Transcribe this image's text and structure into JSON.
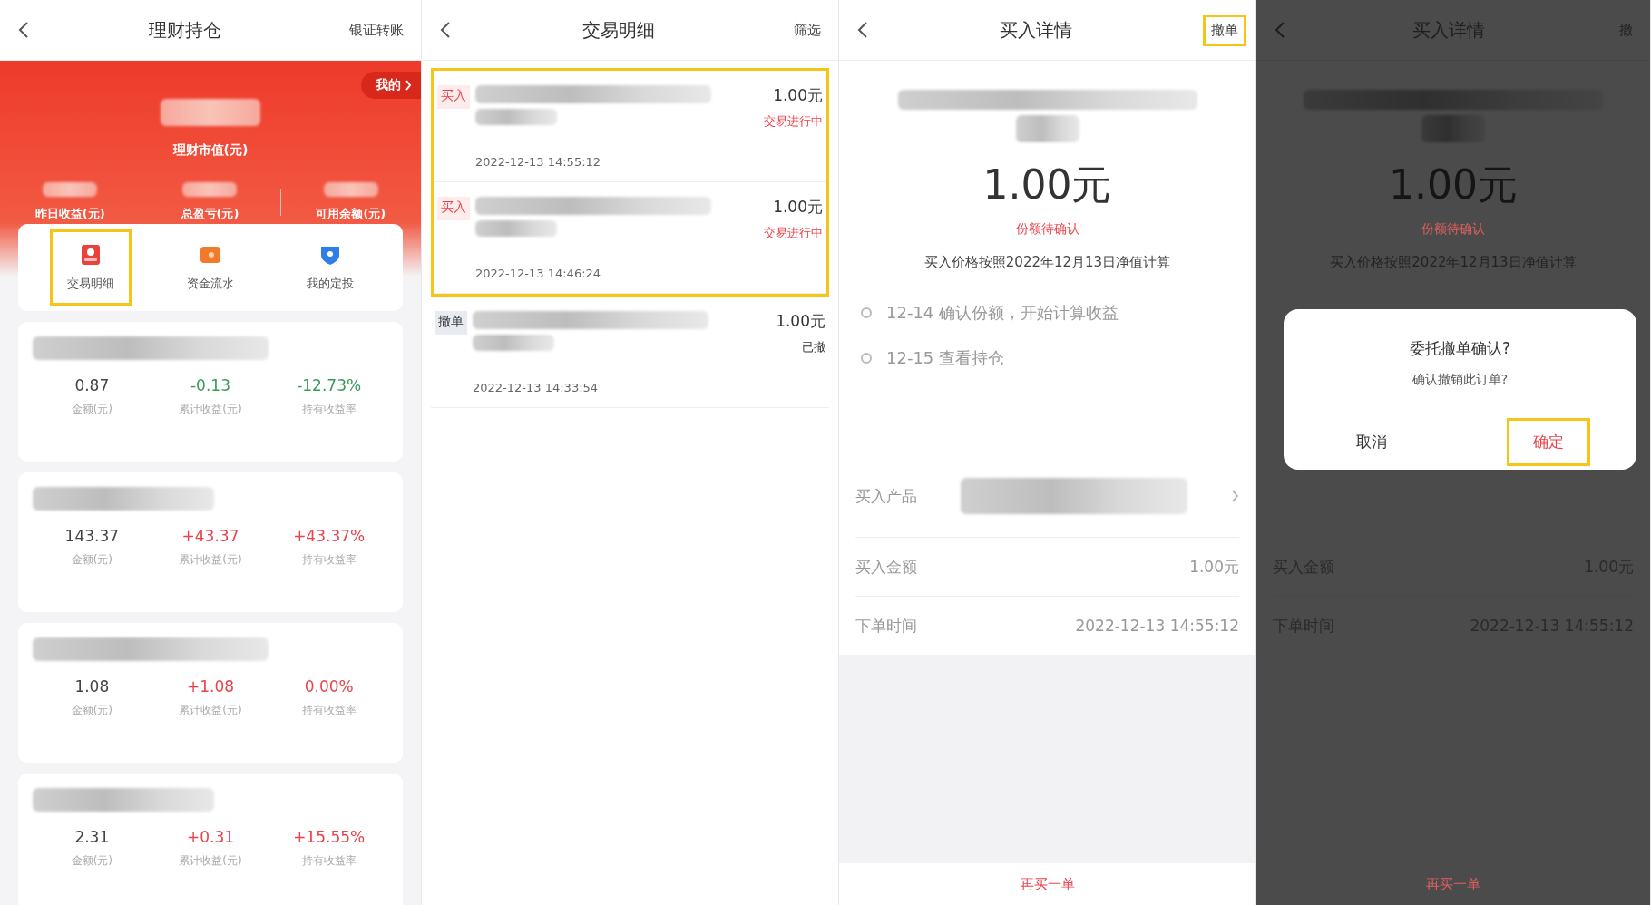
{
  "screens": [
    {
      "kind": "holdings",
      "header": {
        "title": "理财持仓",
        "action": {
          "label": "银证转账",
          "highlighted": false
        }
      },
      "summary": {
        "badge": "我的",
        "label": "理财市值(元)",
        "stats": [
          "昨日收益(元)",
          "总盈亏(元)",
          "可用余额(元)"
        ]
      },
      "menu": [
        {
          "label": "交易明细",
          "kind": "record",
          "highlighted": true
        },
        {
          "label": "资金流水",
          "kind": "wallet",
          "highlighted": false
        },
        {
          "label": "我的定投",
          "kind": "plan",
          "highlighted": false
        }
      ],
      "holdings": [
        {
          "amount": "0.87",
          "amount_label": "金额(元)",
          "profit": "-0.13",
          "profit_label": "累计收益(元)",
          "rate": "-12.73%",
          "rate_label": "持有收益率",
          "kind": "loss"
        },
        {
          "amount": "143.37",
          "amount_label": "金额(元)",
          "profit": "+43.37",
          "profit_label": "累计收益(元)",
          "rate": "+43.37%",
          "rate_label": "持有收益率",
          "kind": "gain"
        },
        {
          "amount": "1.08",
          "amount_label": "金额(元)",
          "profit": "+1.08",
          "profit_label": "累计收益(元)",
          "rate": "0.00%",
          "rate_label": "持有收益率",
          "kind": "gain"
        },
        {
          "amount": "2.31",
          "amount_label": "金额(元)",
          "profit": "+0.31",
          "profit_label": "累计收益(元)",
          "rate": "+15.55%",
          "rate_label": "持有收益率",
          "kind": "gain"
        }
      ]
    },
    {
      "kind": "transactions",
      "header": {
        "title": "交易明细",
        "action": {
          "label": "筛选",
          "highlighted": false
        }
      },
      "records": [
        {
          "kind": "buy",
          "tag": "买入",
          "amount": "1.00元",
          "status": "交易进行中",
          "time": "2022-12-13 14:55:12",
          "highlighted": true
        },
        {
          "kind": "buy",
          "tag": "买入",
          "amount": "1.00元",
          "status": "交易进行中",
          "time": "2022-12-13 14:46:24",
          "highlighted": true
        },
        {
          "kind": "cancel",
          "tag": "撤单",
          "amount": "1.00元",
          "status": "已撤",
          "time": "2022-12-13 14:33:54",
          "highlighted": false
        }
      ]
    },
    {
      "kind": "detail",
      "dimmed": false,
      "header": {
        "title": "买入详情",
        "action": {
          "label": "撤单",
          "highlighted": true
        }
      },
      "amount": "1.00元",
      "status": "份额待确认",
      "note": "买入价格按照2022年12月13日净值计算",
      "timeline": [
        "12-14 确认份额，开始计算收益",
        "12-15 查看持仓"
      ],
      "rows": [
        {
          "kind": "product",
          "label": "买入产品"
        },
        {
          "kind": "value",
          "label": "买入金额",
          "value": "1.00元"
        },
        {
          "kind": "value",
          "label": "下单时间",
          "value": "2022-12-13 14:55:12"
        }
      ],
      "footer": "再买一单"
    },
    {
      "kind": "detail",
      "dimmed": true,
      "header": {
        "title": "买入详情",
        "action": {
          "label": "撤",
          "highlighted": false
        }
      },
      "amount": "1.00元",
      "status": "份额待确认",
      "note": "买入价格按照2022年12月13日净值计算",
      "dialog": {
        "title": "委托撤单确认?",
        "message": "确认撤销此订单?",
        "buttons": [
          {
            "label": "取消",
            "primary": false,
            "highlighted": false
          },
          {
            "label": "确定",
            "primary": true,
            "highlighted": true
          }
        ]
      },
      "rows": [
        {
          "kind": "value",
          "label": "买入金额",
          "value": "1.00元"
        },
        {
          "kind": "value",
          "label": "下单时间",
          "value": "2022-12-13 14:55:12"
        }
      ],
      "footer": "再买一单"
    }
  ]
}
